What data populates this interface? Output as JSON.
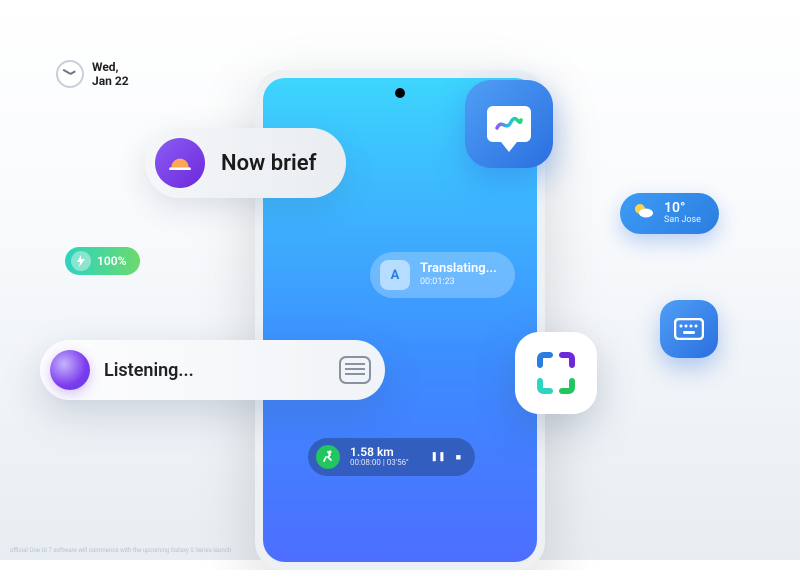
{
  "date": {
    "line1": "Wed,",
    "line2": "Jan 22"
  },
  "now_brief": {
    "label": "Now brief"
  },
  "battery": {
    "percent": "100%"
  },
  "translating": {
    "title": "Translating...",
    "time": "00:01:23"
  },
  "listening": {
    "label": "Listening..."
  },
  "weather": {
    "temp": "10°",
    "location": "San Jose"
  },
  "running": {
    "distance": "1.58 km",
    "time": "00:08:00 | 03'56''"
  },
  "footnote": "official One UI 7 software will commence with the upcoming Galaxy S Series launch",
  "icons": {
    "clock": "clock-icon",
    "now_brief": "sunset-icon",
    "canvas": "easel-icon",
    "weather": "sun-cloud-icon",
    "battery": "bolt-icon",
    "translate": "translate-icon",
    "listen_orb": "orb-icon",
    "keyboard_mini": "keyboard-icon",
    "scanner": "scan-icon",
    "keyboard_app": "keyboard-icon",
    "run": "running-icon",
    "pause": "pause-icon",
    "stop": "stop-icon"
  },
  "colors": {
    "accent_blue": "#2b6fe0",
    "accent_purple": "#7c3aed",
    "accent_green": "#22c55e",
    "accent_teal": "#2dd4bf"
  }
}
